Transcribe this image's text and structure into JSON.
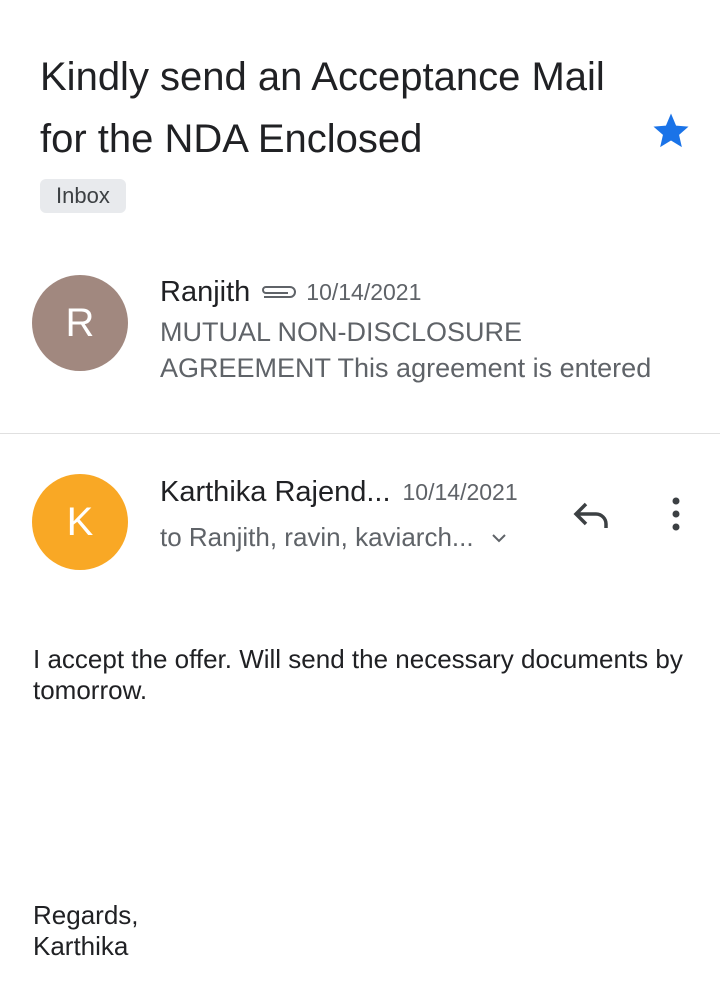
{
  "subject": "Kindly send an Acceptance Mail for the NDA Enclosed",
  "label": "Inbox",
  "colors": {
    "star": "#1a73e8",
    "avatar1": "#a1887f",
    "avatar2": "#f9a825"
  },
  "messages": [
    {
      "initial": "R",
      "sender": "Ranjith",
      "date": "10/14/2021",
      "snippet": "MUTUAL NON-DISCLOSURE AGREEMENT This agreement is entered"
    },
    {
      "initial": "K",
      "sender": "Karthika Rajend...",
      "date": "10/14/2021",
      "recipients": "to Ranjith, ravin, kaviarch..."
    }
  ],
  "body": {
    "line1": "I accept the offer. Will send the necessary documents by tomorrow.",
    "regards": "Regards,",
    "signature": "Karthika"
  }
}
